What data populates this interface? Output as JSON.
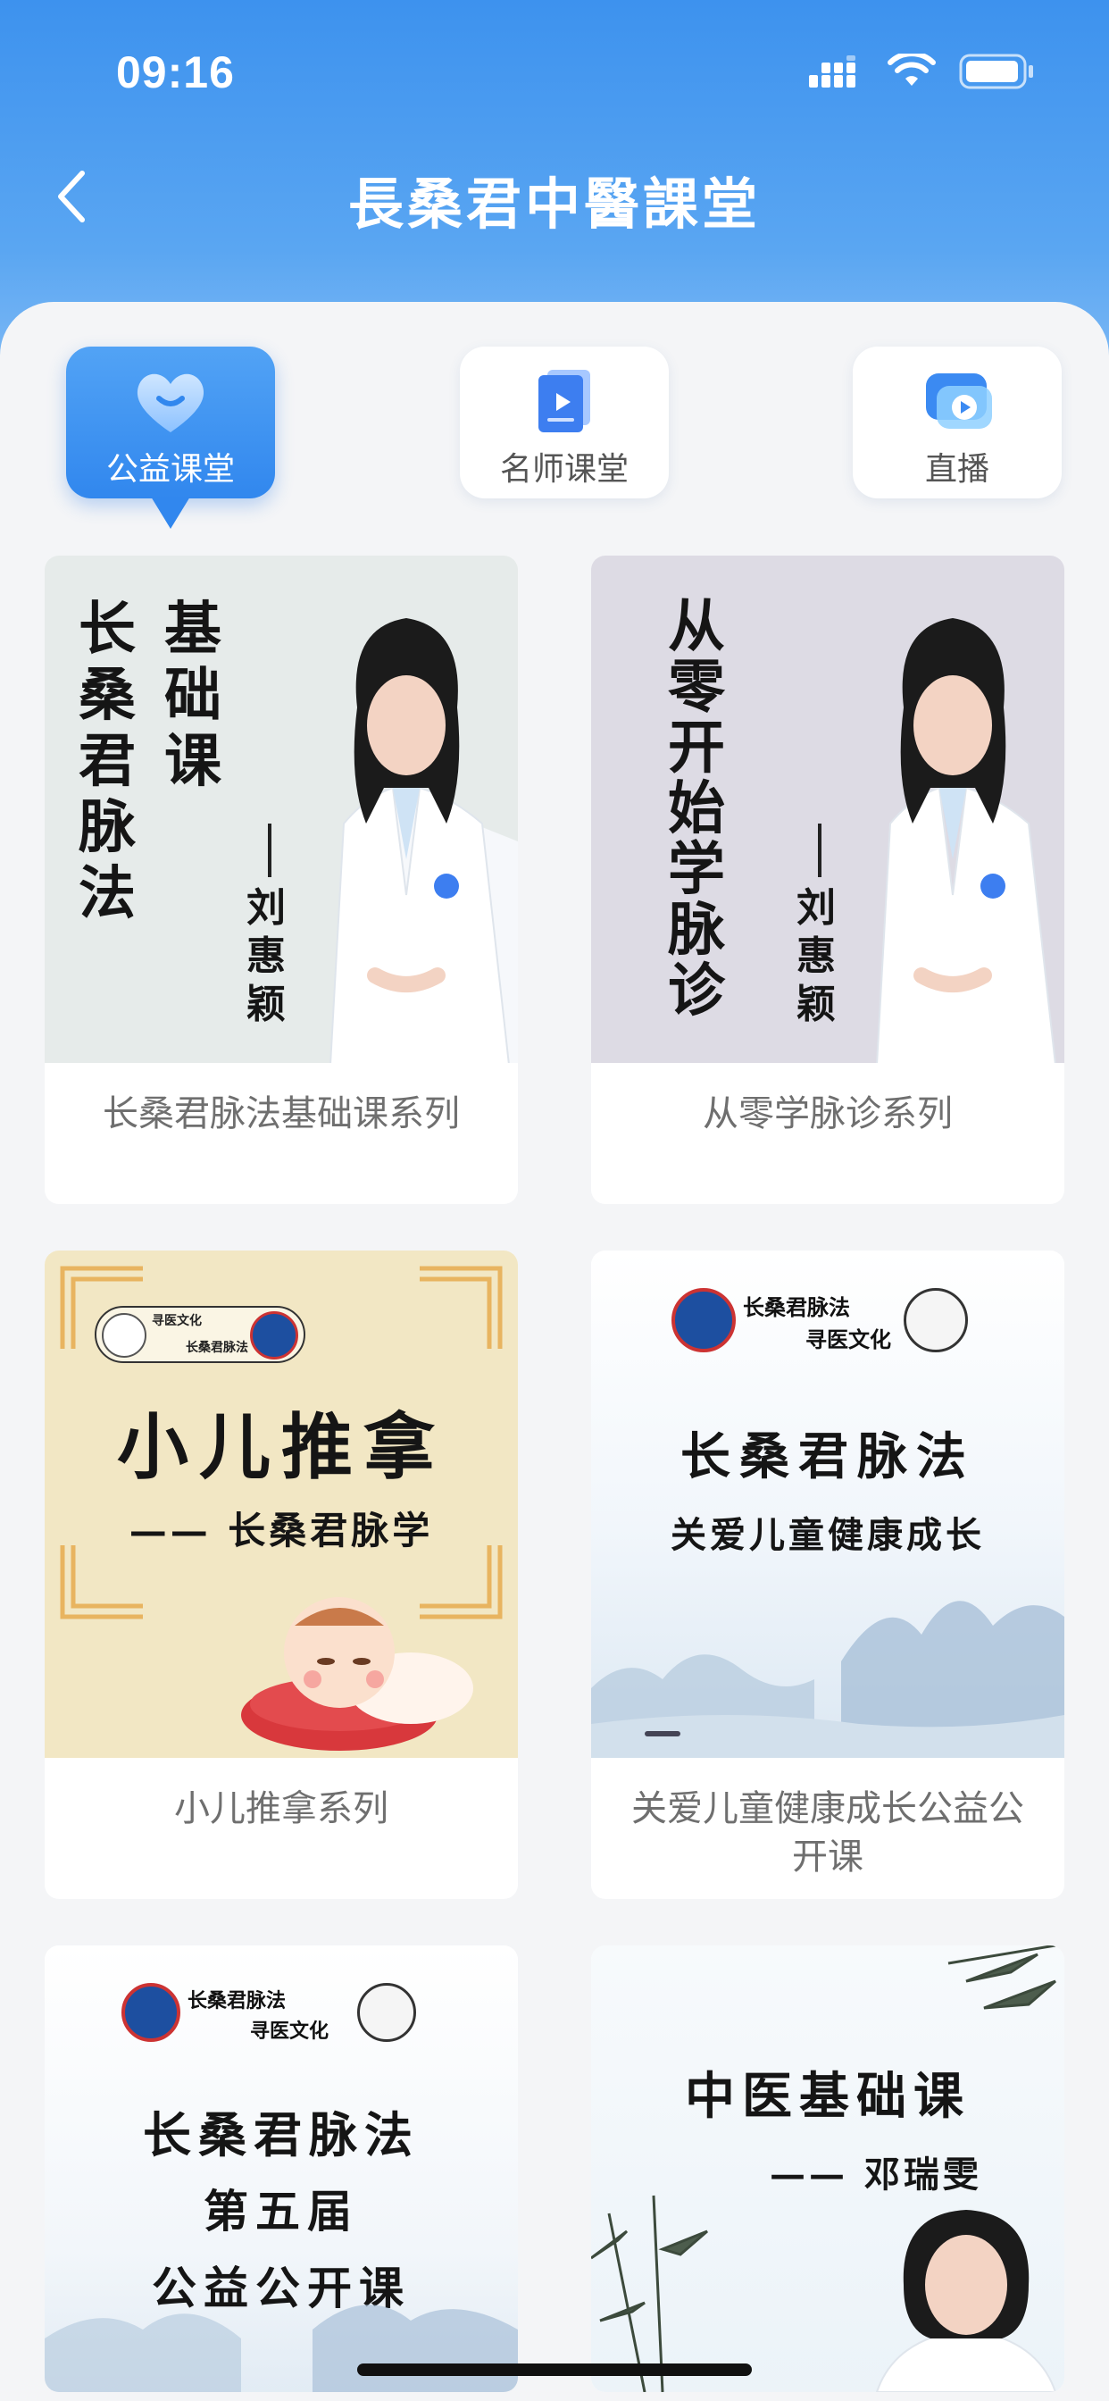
{
  "status": {
    "time": "09:16"
  },
  "nav": {
    "title": "長桑君中醫課堂"
  },
  "tabs": [
    {
      "label": "公益课堂",
      "active": true,
      "icon": "heart-icon"
    },
    {
      "label": "名师课堂",
      "active": false,
      "icon": "book-icon"
    },
    {
      "label": "直播",
      "active": false,
      "icon": "video-play-icon"
    }
  ],
  "courses": [
    {
      "title": "长桑君脉法基础课系列",
      "art": {
        "col1": "长桑君脉法",
        "col2": "基础课",
        "author": "刘惠颖"
      }
    },
    {
      "title": "从零学脉诊系列",
      "art": {
        "col1": "从零开始学脉诊",
        "author": "刘惠颖"
      }
    },
    {
      "title": "小儿推拿系列",
      "art": {
        "logo1": "寻医文化",
        "logo2": "长桑君脉法",
        "heading": "小儿推拿",
        "sub": "—— 长桑君脉学"
      }
    },
    {
      "title": "关爱儿童健康成长公益公开课",
      "art": {
        "logo1": "长桑君脉法",
        "logo2": "寻医文化",
        "heading": "长桑君脉法",
        "sub": "关爱儿童健康成长"
      }
    },
    {
      "title": "",
      "art": {
        "logo1": "长桑君脉法",
        "logo2": "寻医文化",
        "line1": "长桑君脉法",
        "line2": "第五届",
        "line3": "公益公开课"
      }
    },
    {
      "title": "",
      "art": {
        "heading": "中医基础课",
        "sub": "—— 邓瑞雯"
      }
    }
  ],
  "colors": {
    "brand": "#3d92ee",
    "card_title": "#6f6f6f"
  }
}
